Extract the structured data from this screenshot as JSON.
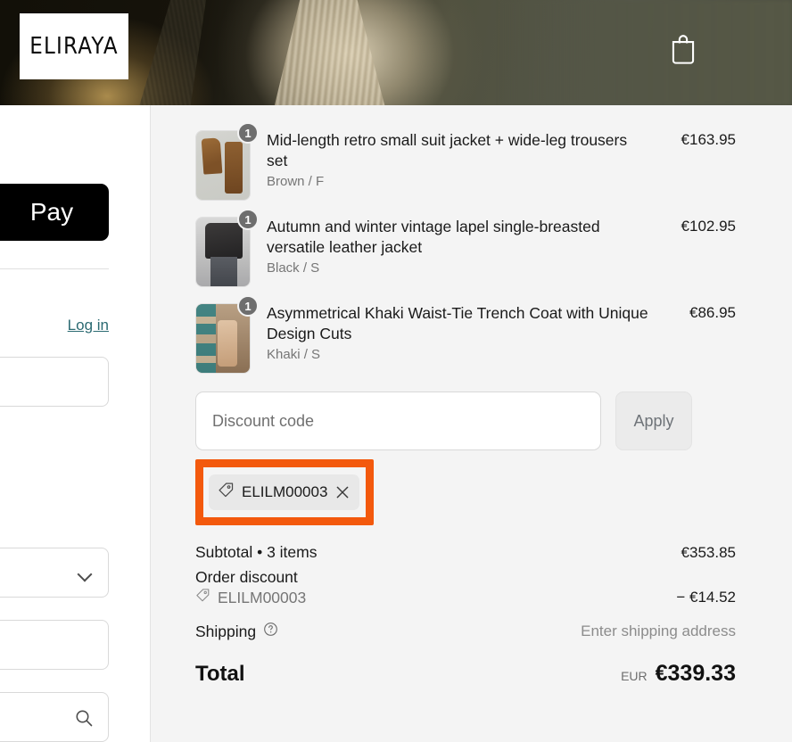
{
  "brand": {
    "logo_text": "ELIRAYA"
  },
  "header": {
    "cart_icon": "shopping-bag-icon"
  },
  "left_panel": {
    "pay_button_label": "Pay",
    "login_link_label": "Log in",
    "country_select_icon": "chevron-down-icon",
    "address_search_icon": "search-icon"
  },
  "order_summary": {
    "items": [
      {
        "title": "Mid-length retro small suit jacket + wide-leg trousers set",
        "variant": "Brown / F",
        "price": "€163.95",
        "qty": "1",
        "thumb_class": "img-suit"
      },
      {
        "title": "Autumn and winter vintage lapel single-breasted versatile leather jacket",
        "variant": "Black / S",
        "price": "€102.95",
        "qty": "1",
        "thumb_class": "img-jacket"
      },
      {
        "title": "Asymmetrical Khaki Waist-Tie Trench Coat with Unique Design Cuts",
        "variant": "Khaki / S",
        "price": "€86.95",
        "qty": "1",
        "thumb_class": "img-trench"
      }
    ],
    "discount": {
      "placeholder": "Discount code",
      "value": "",
      "apply_label": "Apply",
      "applied_code": "ELILM00003",
      "tag_icon": "tag-icon",
      "remove_icon": "close-icon",
      "highlight_color": "#f3590d"
    },
    "totals": {
      "subtotal_label": "Subtotal • 3 items",
      "subtotal_value": "€353.85",
      "order_discount_label": "Order discount",
      "order_discount_code": "ELILM00003",
      "order_discount_value": "− €14.52",
      "shipping_label": "Shipping",
      "shipping_help_icon": "question-mark-circle-icon",
      "shipping_value": "Enter shipping address",
      "total_label": "Total",
      "total_currency": "EUR",
      "total_value": "€339.33"
    }
  }
}
